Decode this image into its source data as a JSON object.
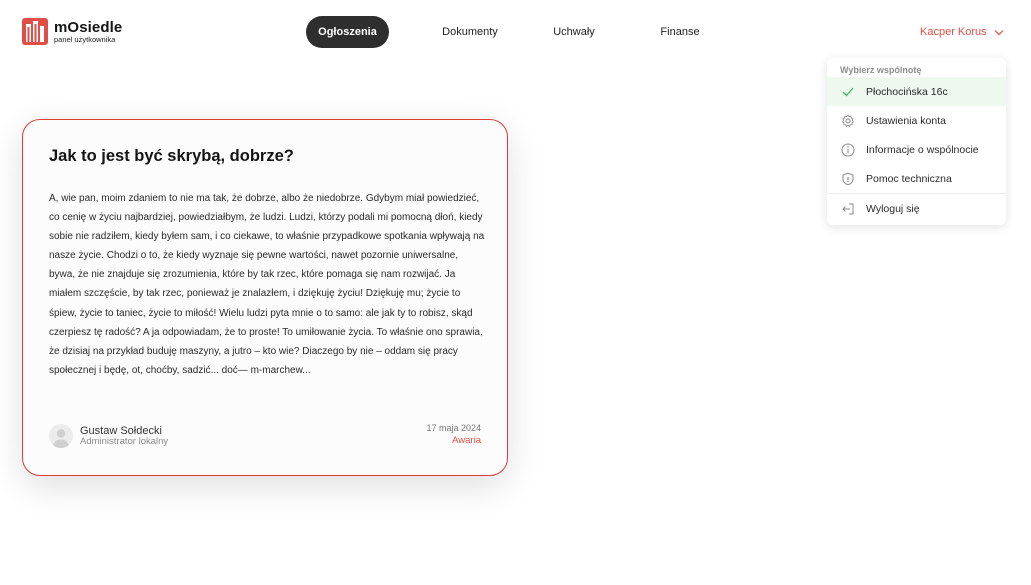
{
  "brand": {
    "name": "mOsiedle",
    "subtitle": "panel użytkownika",
    "logo_color": "#e04e46"
  },
  "nav": {
    "items": [
      {
        "label": "Ogłoszenia",
        "active": true
      },
      {
        "label": "Dokumenty",
        "active": false
      },
      {
        "label": "Uchwały",
        "active": false
      },
      {
        "label": "Finanse",
        "active": false
      }
    ]
  },
  "user": {
    "name": "Kacper Korus",
    "icon": "chevron-down-icon"
  },
  "dropdown": {
    "heading": "Wybierz wspólnotę",
    "items": [
      {
        "label": "Płochocińska 16c",
        "icon": "check-icon",
        "selected": true
      },
      {
        "label": "Ustawienia konta",
        "icon": "gear-icon",
        "selected": false
      },
      {
        "label": "Informacje o wspólnocie",
        "icon": "info-icon",
        "selected": false
      },
      {
        "label": "Pomoc techniczna",
        "icon": "shield-icon",
        "selected": false
      },
      {
        "label": "Wyloguj się",
        "icon": "logout-icon",
        "selected": false
      }
    ]
  },
  "post": {
    "title": "Jak to jest być skrybą, dobrze?",
    "body": "A, wie pan, moim zdaniem to nie ma tak, że dobrze, albo że niedobrze. Gdybym miał powiedzieć, co cenię w życiu najbardziej, powiedziałbym, że ludzi. Ludzi, którzy podali mi pomocną dłoń, kiedy sobie nie radziłem, kiedy byłem sam, i co ciekawe, to właśnie przypadkowe spotkania wpływają na nasze życie. Chodzi o to, że kiedy wyznaje się pewne wartości, nawet pozornie uniwersalne, bywa, że nie znajduje się zrozumienia, które by tak rzec, które pomaga się nam rozwijać. Ja miałem szczęście, by tak rzec, ponieważ je znalazłem, i dziękuję życiu! Dziękuję mu; życie to śpiew, życie to taniec, życie to miłość! Wielu ludzi pyta mnie o to samo: ale jak ty to robisz, skąd czerpiesz tę radość? A ja odpowiadam, że to proste! To umiłowanie życia. To właśnie ono sprawia, że dzisiaj na przykład buduję maszyny, a jutro – kto wie? Diaczego by nie – oddam się pracy społecznej i będę, ot, choćby, sadzić... doć— m-marchew...",
    "author_name": "Gustaw Sołdecki",
    "author_role": "Administrator lokalny",
    "date": "17 maja 2024",
    "tag": "Awaria",
    "accent_color": "#dc3c3c"
  }
}
